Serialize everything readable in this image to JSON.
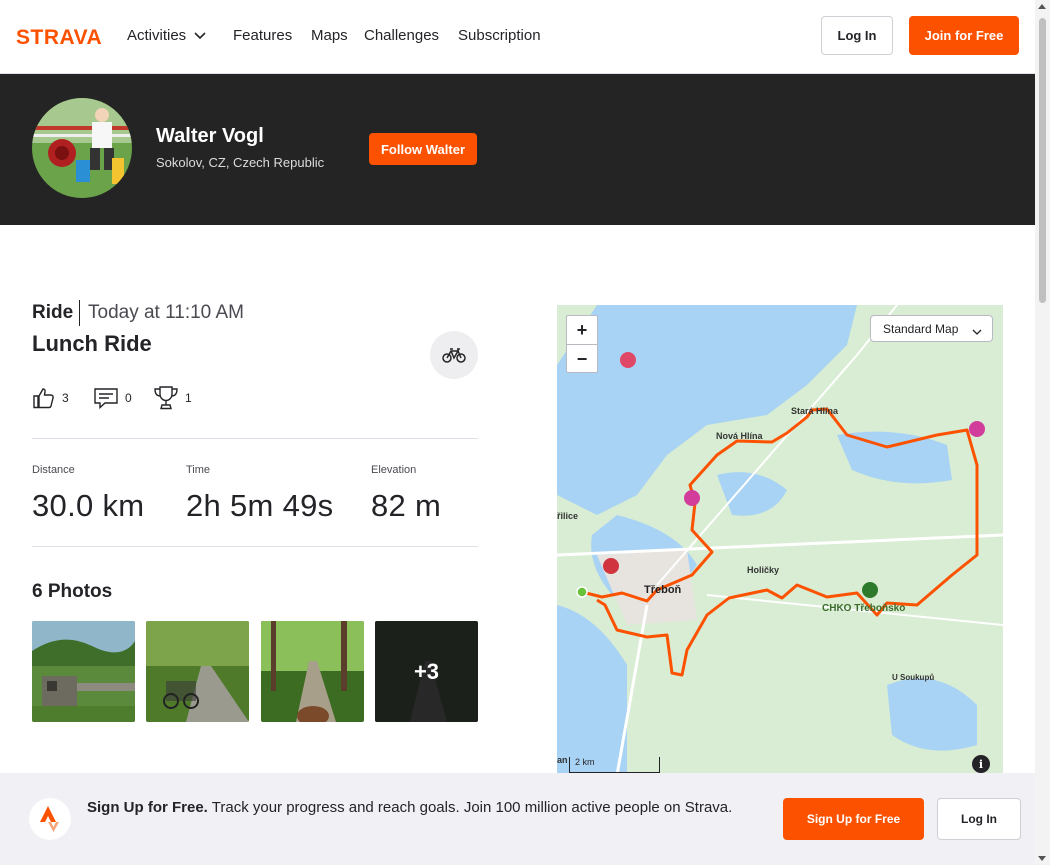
{
  "nav": {
    "logo_text": "STRAVA",
    "items": [
      {
        "label": "Activities",
        "has_dropdown": true
      },
      {
        "label": "Features"
      },
      {
        "label": "Maps"
      },
      {
        "label": "Challenges"
      },
      {
        "label": "Subscription"
      }
    ],
    "login_label": "Log In",
    "join_label": "Join for Free"
  },
  "athlete": {
    "name": "Walter Vogl",
    "location": "Sokolov, CZ, Czech Republic",
    "follow_label": "Follow Walter"
  },
  "activity": {
    "type": "Ride",
    "time": "Today at 11:10 AM",
    "title": "Lunch Ride",
    "sport_icon": "bike-icon",
    "kudos": "3",
    "comments": "0",
    "achievements": "1"
  },
  "stats": [
    {
      "label": "Distance",
      "value": "30.0 km"
    },
    {
      "label": "Time",
      "value": "2h 5m 49s"
    },
    {
      "label": "Elevation",
      "value": "82 m"
    }
  ],
  "photos": {
    "heading": "6 Photos",
    "more_label": "+3"
  },
  "map": {
    "style_label": "Standard Map",
    "zoom_in": "+",
    "zoom_out": "−",
    "scale_label": "2 km",
    "info_label": "i",
    "places": [
      {
        "name": "Stará Hlína"
      },
      {
        "name": "Nová Hlína"
      },
      {
        "name": "řilice"
      },
      {
        "name": "Holičky"
      },
      {
        "name": "Třeboň"
      },
      {
        "name": "CHKO Třeboňsko"
      },
      {
        "name": "U Soukupů"
      },
      {
        "name": "an"
      }
    ]
  },
  "banner": {
    "headline": "Sign Up for Free.",
    "body": "Track your progress and reach goals. Join 100 million active people on Strava.",
    "signup_label": "Sign Up for Free",
    "login_label": "Log In"
  },
  "colors": {
    "brand": "#fc5200",
    "dark": "#242424"
  }
}
